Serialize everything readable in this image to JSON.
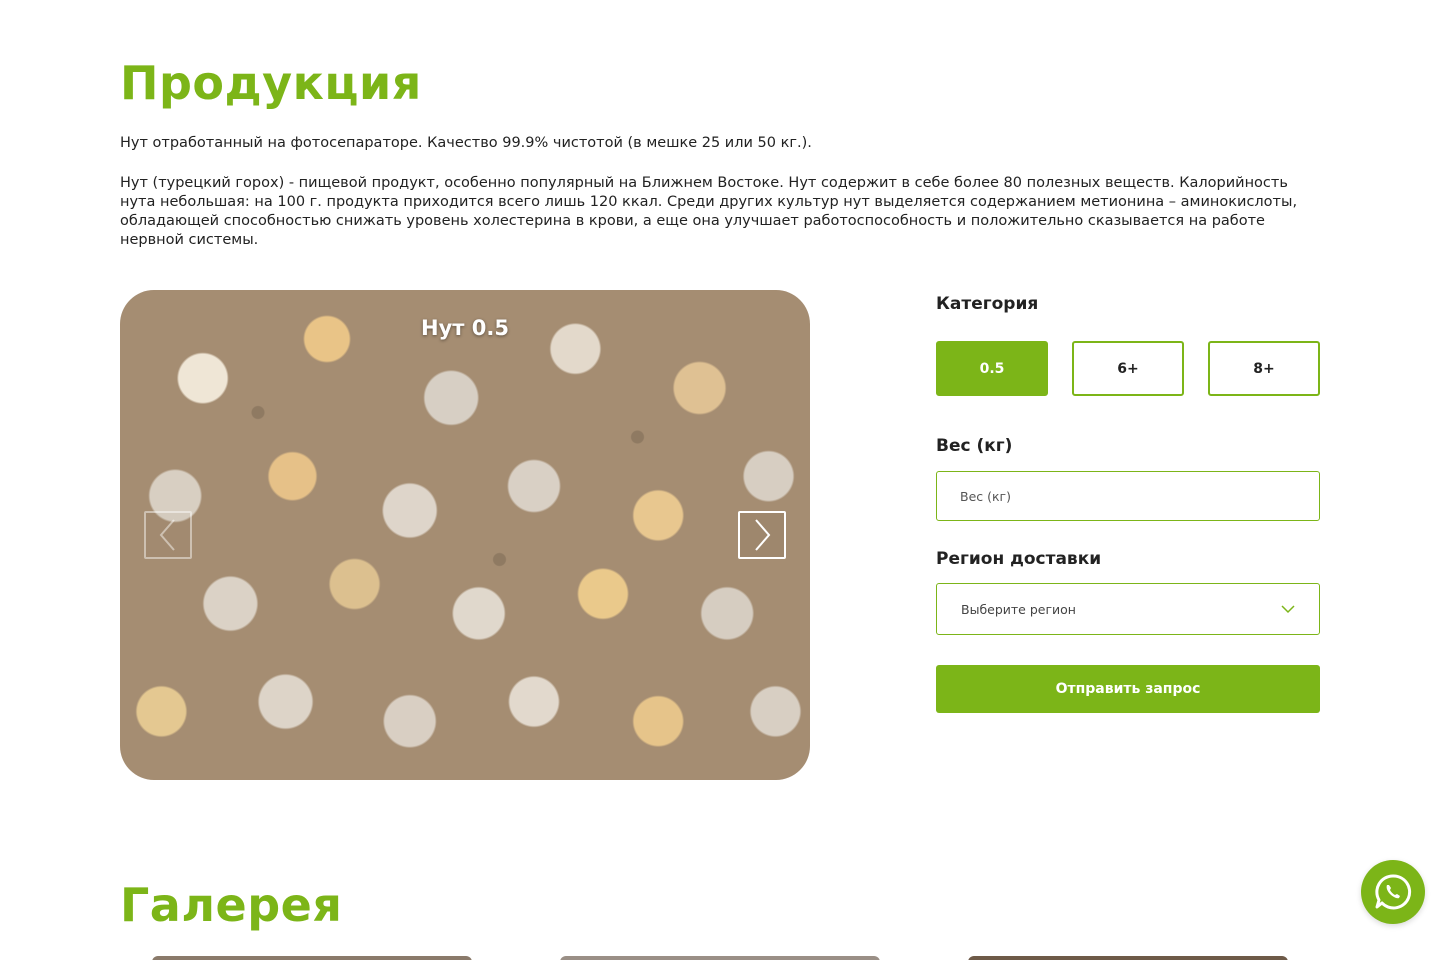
{
  "products": {
    "title": "Продукция",
    "desc_short": "Нут отработанный на фотосепараторе. Качество 99.9% чистотой (в мешке 25 или 50 кг.).",
    "desc_long": "Нут (турецкий горох) - пищевой продукт, особенно популярный на Ближнем Востоке. Нут содержит в себе более 80 полезных веществ. Калорийность нута небольшая: на 100 г. продукта приходится всего лишь 120 ккал. Среди других культур нут выделяется содержанием метионина – аминокислоты, обладающей способностью снижать уровень холестерина в крови, а еще она улучшает работоспособность и положительно сказывается на работе нервной системы."
  },
  "slider": {
    "caption": "Нут 0.5",
    "prev_icon": "chevron-left-icon",
    "next_icon": "chevron-right-icon"
  },
  "form": {
    "category_label": "Категория",
    "categories": [
      "0.5",
      "6+",
      "8+"
    ],
    "selected_category": "0.5",
    "weight_label": "Вес (кг)",
    "weight_placeholder": "Вес (кг)",
    "weight_value": "",
    "region_label": "Регион доставки",
    "region_placeholder": "Выберите регион",
    "submit_label": "Отправить запрос"
  },
  "gallery": {
    "title": "Галерея"
  },
  "colors": {
    "accent": "#7cb518",
    "text": "#222222",
    "background": "#ffffff"
  },
  "icons": {
    "whatsapp": "whatsapp-icon",
    "dropdown": "chevron-down-icon"
  }
}
